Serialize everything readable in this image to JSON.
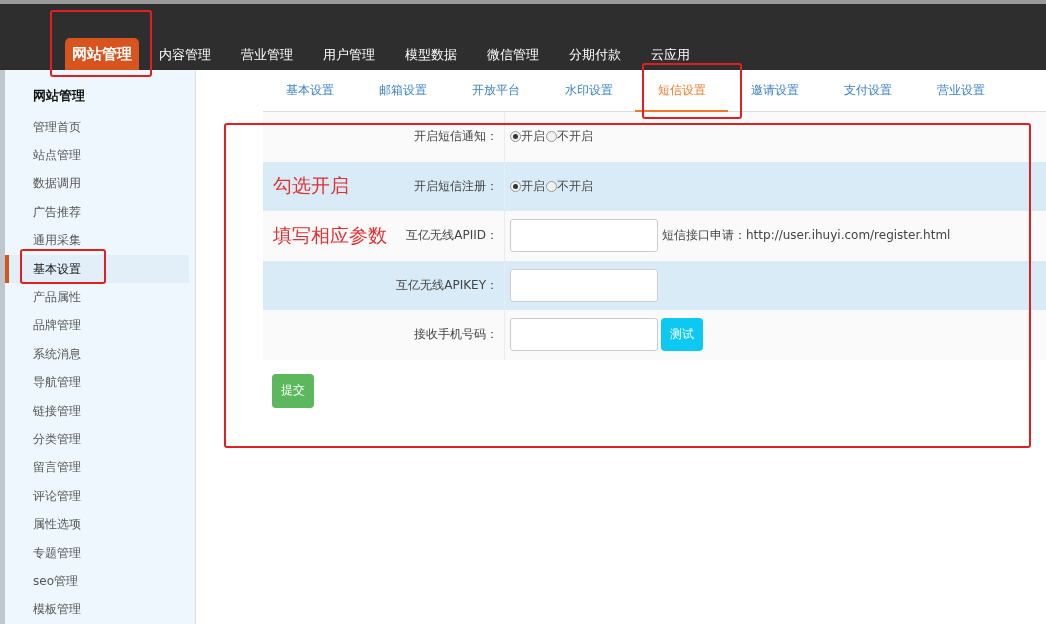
{
  "top_nav": [
    {
      "label": "网站管理",
      "selected": true
    },
    {
      "label": "内容管理",
      "selected": false
    },
    {
      "label": "营业管理",
      "selected": false
    },
    {
      "label": "用户管理",
      "selected": false
    },
    {
      "label": "模型数据",
      "selected": false
    },
    {
      "label": "微信管理",
      "selected": false
    },
    {
      "label": "分期付款",
      "selected": false
    },
    {
      "label": "云应用",
      "selected": false
    }
  ],
  "sidebar": {
    "title": "网站管理",
    "items": [
      {
        "label": "管理首页",
        "selected": false
      },
      {
        "label": "站点管理",
        "selected": false
      },
      {
        "label": "数据调用",
        "selected": false
      },
      {
        "label": "广告推荐",
        "selected": false
      },
      {
        "label": "通用采集",
        "selected": false
      },
      {
        "label": "基本设置",
        "selected": true
      },
      {
        "label": "产品属性",
        "selected": false
      },
      {
        "label": "品牌管理",
        "selected": false
      },
      {
        "label": "系统消息",
        "selected": false
      },
      {
        "label": "导航管理",
        "selected": false
      },
      {
        "label": "链接管理",
        "selected": false
      },
      {
        "label": "分类管理",
        "selected": false
      },
      {
        "label": "留言管理",
        "selected": false
      },
      {
        "label": "评论管理",
        "selected": false
      },
      {
        "label": "属性选项",
        "selected": false
      },
      {
        "label": "专题管理",
        "selected": false
      },
      {
        "label": "seo管理",
        "selected": false
      },
      {
        "label": "模板管理",
        "selected": false
      }
    ]
  },
  "tabs": [
    {
      "label": "基本设置",
      "selected": false
    },
    {
      "label": "邮箱设置",
      "selected": false
    },
    {
      "label": "开放平台",
      "selected": false
    },
    {
      "label": "水印设置",
      "selected": false
    },
    {
      "label": "短信设置",
      "selected": true
    },
    {
      "label": "邀请设置",
      "selected": false
    },
    {
      "label": "支付设置",
      "selected": false
    },
    {
      "label": "营业设置",
      "selected": false
    }
  ],
  "form": {
    "rows": [
      {
        "kind": "radio",
        "label": "开启短信通知：",
        "options": [
          {
            "label": "开启",
            "selected": true
          },
          {
            "label": "不开启",
            "selected": false
          }
        ]
      },
      {
        "kind": "radio",
        "label": "开启短信注册：",
        "annotation": "勾选开启",
        "options": [
          {
            "label": "开启",
            "selected": true
          },
          {
            "label": "不开启",
            "selected": false
          }
        ]
      },
      {
        "kind": "input",
        "label": "互亿无线APIID：",
        "annotation": "填写相应参数",
        "hint": "短信接口申请：http://user.ihuyi.com/register.html"
      },
      {
        "kind": "input",
        "label": "互亿无线APIKEY："
      },
      {
        "kind": "input",
        "label": "接收手机号码：",
        "button": "测试"
      }
    ],
    "submit": "提交"
  }
}
